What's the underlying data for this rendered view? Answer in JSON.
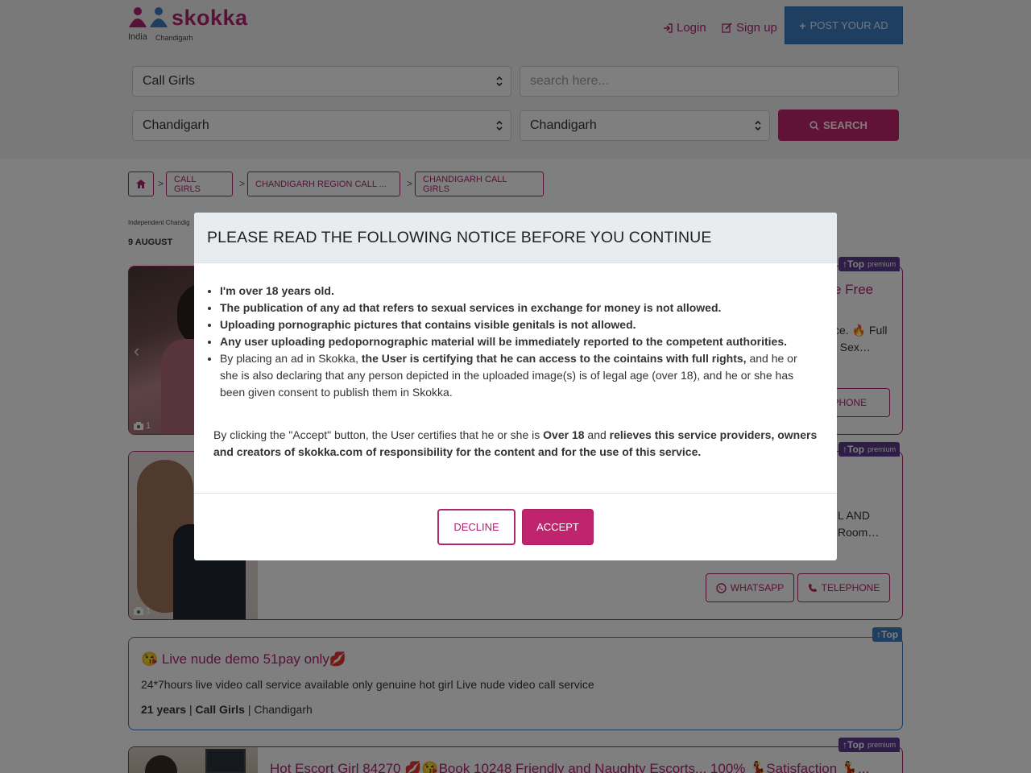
{
  "brand": {
    "name": "skokka",
    "country": "India",
    "city": "Chandigarh"
  },
  "header": {
    "login": "Login",
    "signup": "Sign up",
    "post_ad": "POST YOUR AD"
  },
  "search": {
    "category": "Call Girls",
    "placeholder": "search here...",
    "region": "Chandigarh",
    "city": "Chandigarh",
    "button": "SEARCH"
  },
  "breadcrumb": [
    "CALL GIRLS",
    "CHANDIGARH REGION CALL ...",
    "CHANDIGARH CALL GIRLS"
  ],
  "page": {
    "subtitle": "Independent Chandig",
    "date": "9 AUGUST"
  },
  "listings": [
    {
      "badge": "Top",
      "badge_extra": "premium",
      "title_fragment": "e Free",
      "desc_fragment_1": "ce. 🔥 Full",
      "desc_fragment_2": ", Sex…",
      "photo_count": "1",
      "telephone": "LEPHONE"
    },
    {
      "badge": "Top",
      "badge_extra": "premium",
      "desc_fragment_1": "L AND",
      "desc_fragment_2": "Room…",
      "photo_count": "1",
      "whatsapp": "WHATSAPP",
      "telephone": "TELEPHONE"
    },
    {
      "badge": "Top",
      "title": "😘 Live nude demo 51pay only💋",
      "desc": "24*7hours live video call service available only genuine hot girl Live nude video call service",
      "age": "21 years",
      "sep": "|",
      "category": "Call Girls",
      "city": "Chandigarh"
    },
    {
      "badge": "Top",
      "badge_extra": "premium",
      "title": "Hot Escort Girl 84270 💋😘Book 10248 Friendly and Naughty Escorts... 100% 💃Satisfaction 💃..."
    }
  ],
  "modal": {
    "title": "PLEASE READ THE FOLLOWING NOTICE BEFORE YOU CONTINUE",
    "items": [
      "I'm over 18 years old.",
      "The publication of any ad that refers to sexual services in exchange for money is not allowed.",
      "Uploading pornographic pictures that contains visible genitals is not allowed.",
      "Any user uploading pedopornographic material will be immediately reported to the competent authorities."
    ],
    "item5_a": "By placing an ad in Skokka, ",
    "item5_b": "the User is certifying that he can access to the cointains with full rights,",
    "item5_c": " and he or she is also declaring that any person depicted in the uploaded image(s) is of legal age (over 18), and he or she has been given consent to publish them in Skokka.",
    "para_a": "By clicking the \"Accept\" button, the User certifies that he or she is ",
    "para_b": "Over 18",
    "para_c": " and ",
    "para_d": "relieves this service providers, owners and creators of skokka.com of responsibility for the content and for the use of this service.",
    "decline": "DECLINE",
    "accept": "ACCEPT"
  },
  "colors": {
    "brand": "#b12470",
    "accent_button": "#c1246f",
    "post_button": "#3c7fc1",
    "premium_badge": "#5c3c8e"
  }
}
